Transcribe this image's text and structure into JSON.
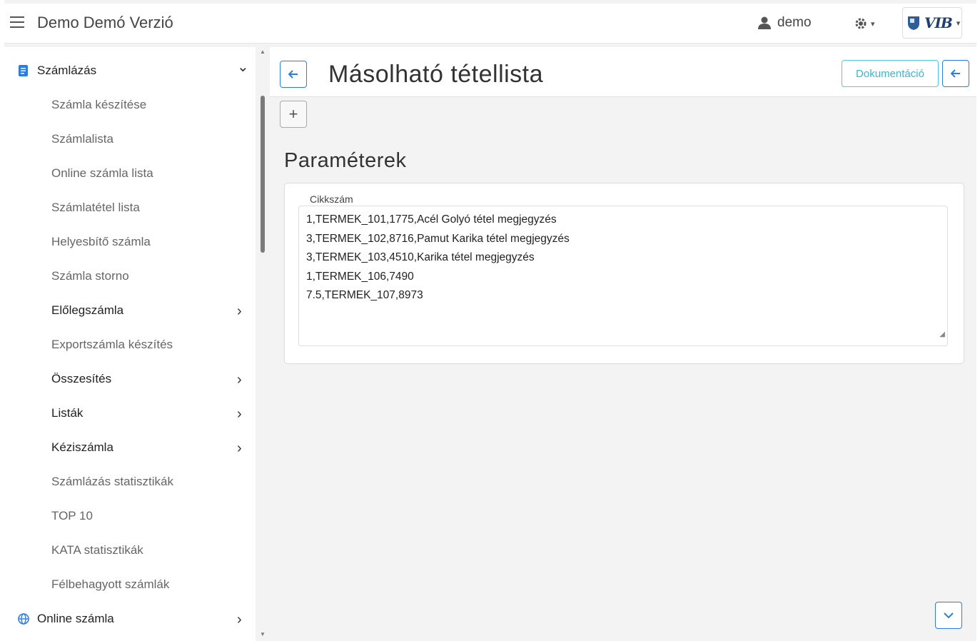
{
  "header": {
    "app_title": "Demo Demó Verzió",
    "user": "demo",
    "logo_text": "VIB"
  },
  "sidebar": {
    "items": [
      {
        "label": "Számlázás",
        "icon": "document-icon",
        "chevron": "⌄"
      },
      {
        "label": "Számla készítése"
      },
      {
        "label": "Számlalista"
      },
      {
        "label": "Online számla lista"
      },
      {
        "label": "Számlatétel lista"
      },
      {
        "label": "Helyesbítő számla"
      },
      {
        "label": "Számla storno"
      },
      {
        "label": "Előlegszámla",
        "chevron": "›"
      },
      {
        "label": "Exportszámla készítés"
      },
      {
        "label": "Összesítés",
        "chevron": "›"
      },
      {
        "label": "Listák",
        "chevron": "›"
      },
      {
        "label": "Kéziszámla",
        "chevron": "›"
      },
      {
        "label": "Számlázás statisztikák"
      },
      {
        "label": "TOP 10"
      },
      {
        "label": "KATA statisztikák"
      },
      {
        "label": "Félbehagyott számlák"
      },
      {
        "label": "Online számla",
        "icon": "globe-icon",
        "chevron": "›"
      }
    ]
  },
  "main": {
    "title": "Másolható tétellista",
    "doc_button": "Dokumentáció",
    "add_button": "+",
    "section_title": "Paraméterek",
    "field_label": "Cikkszám",
    "lines": [
      "1,TERMEK_101,1775,Acél Golyó tétel megjegyzés",
      "3,TERMEK_102,8716,Pamut Karika tétel megjegyzés",
      "3,TERMEK_103,4510,Karika tétel megjegyzés",
      "1,TERMEK_106,7490",
      "7.5,TERMEK_107,8973"
    ]
  },
  "colors": {
    "accent": "#2d7de1",
    "info": "#3bb6d6"
  }
}
